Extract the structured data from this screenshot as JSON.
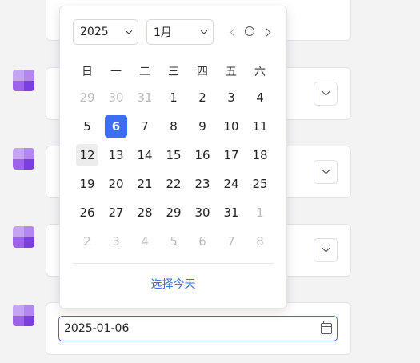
{
  "form": {
    "date_value": "2025-01-06"
  },
  "datepicker": {
    "year": "2025",
    "month": "1月",
    "weekdays": [
      "日",
      "一",
      "二",
      "三",
      "四",
      "五",
      "六"
    ],
    "weeks": [
      [
        {
          "d": "29",
          "o": true
        },
        {
          "d": "30",
          "o": true
        },
        {
          "d": "31",
          "o": true
        },
        {
          "d": "1"
        },
        {
          "d": "2"
        },
        {
          "d": "3"
        },
        {
          "d": "4"
        }
      ],
      [
        {
          "d": "5"
        },
        {
          "d": "6",
          "s": true
        },
        {
          "d": "7"
        },
        {
          "d": "8"
        },
        {
          "d": "9"
        },
        {
          "d": "10"
        },
        {
          "d": "11"
        }
      ],
      [
        {
          "d": "12",
          "t": true
        },
        {
          "d": "13"
        },
        {
          "d": "14"
        },
        {
          "d": "15"
        },
        {
          "d": "16"
        },
        {
          "d": "17"
        },
        {
          "d": "18"
        }
      ],
      [
        {
          "d": "19"
        },
        {
          "d": "20"
        },
        {
          "d": "21"
        },
        {
          "d": "22"
        },
        {
          "d": "23"
        },
        {
          "d": "24"
        },
        {
          "d": "25"
        }
      ],
      [
        {
          "d": "26"
        },
        {
          "d": "27"
        },
        {
          "d": "28"
        },
        {
          "d": "29"
        },
        {
          "d": "30"
        },
        {
          "d": "31"
        },
        {
          "d": "1",
          "o": true
        }
      ],
      [
        {
          "d": "2",
          "o": true
        },
        {
          "d": "3",
          "o": true
        },
        {
          "d": "4",
          "o": true
        },
        {
          "d": "5",
          "o": true
        },
        {
          "d": "6",
          "o": true
        },
        {
          "d": "7",
          "o": true
        },
        {
          "d": "8",
          "o": true
        }
      ]
    ],
    "today_label": "选择今天"
  },
  "colors": {
    "accent": "#3b6ef0",
    "icon_purple": "#7b3ee0"
  }
}
